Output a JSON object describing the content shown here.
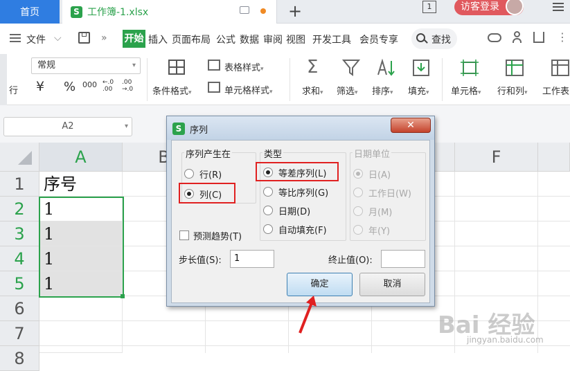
{
  "tabs": {
    "home": "首页",
    "file_icon": "S",
    "file": "工作簿-1.xlsx",
    "new_tab": "+"
  },
  "window": {
    "window_count": "1",
    "login": "访客登录"
  },
  "menu": {
    "file": "文件",
    "items": [
      "开始",
      "插入",
      "页面布局",
      "公式",
      "数据",
      "审阅",
      "视图",
      "开发工具",
      "会员专享"
    ],
    "search": "查找"
  },
  "toolbar": {
    "row_label": "行",
    "number_format": "常规",
    "currency": "¥",
    "percent": "%",
    "thousands": "000",
    "inc_decimal": "←.0\n.00",
    "dec_decimal": ".00\n→.0",
    "cond_format": "条件格式",
    "table_style": "表格样式",
    "cell_style": "单元格样式",
    "sum": "求和",
    "filter": "筛选",
    "sort": "排序",
    "fill": "填充",
    "cell": "单元格",
    "rowcol": "行和列",
    "worksheet": "工作表"
  },
  "formula": {
    "name_box": "A2"
  },
  "grid": {
    "columns": [
      "A",
      "B",
      "F"
    ],
    "rows": [
      "1",
      "2",
      "3",
      "4",
      "5",
      "6",
      "7",
      "8"
    ],
    "cells": [
      "序号",
      "1",
      "1",
      "1",
      "1"
    ]
  },
  "dialog": {
    "icon": "S",
    "title": "序列",
    "close": "✕",
    "group_source": "序列产生在",
    "source_options": [
      "行(R)",
      "列(C)"
    ],
    "source_selected": 1,
    "group_type": "类型",
    "type_options": [
      "等差序列(L)",
      "等比序列(G)",
      "日期(D)",
      "自动填充(F)"
    ],
    "type_selected": 0,
    "group_date": "日期单位",
    "date_options": [
      "日(A)",
      "工作日(W)",
      "月(M)",
      "年(Y)"
    ],
    "date_selected": 0,
    "trend": "预测趋势(T)",
    "step_label": "步长值(S):",
    "step_value": "1",
    "stop_label": "终止值(O):",
    "stop_value": "",
    "ok": "确定",
    "cancel": "取消"
  },
  "watermark": {
    "brand": "Bai 经验",
    "url": "jingyan.baidu.com"
  },
  "colors": {
    "accent_green": "#2ba24c",
    "tab_blue": "#2f7de1",
    "highlight_red": "#e02020"
  }
}
